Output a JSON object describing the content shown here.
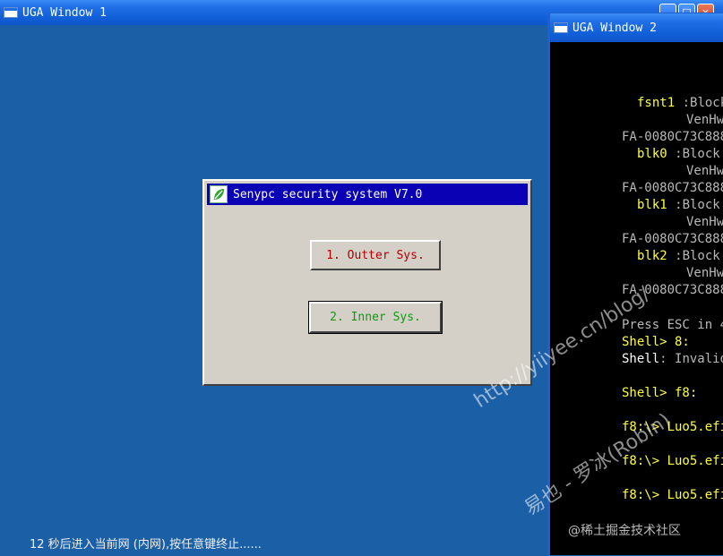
{
  "window1": {
    "title": "UGA Window 1",
    "controls": {
      "minimize": "_",
      "maximize": "□",
      "close": "×"
    }
  },
  "dialog": {
    "title": "Senypc security system V7.0",
    "buttons": [
      {
        "label": "1. Outter Sys.",
        "color": "#b00000"
      },
      {
        "label": "2. Inner Sys.",
        "color": "#0f9a0f"
      }
    ]
  },
  "status_text": "12 秒后进入当前网 (内网),按任意键终止......",
  "window2": {
    "title": "UGA Window 2",
    "console": {
      "lines": [
        {
          "a": "fsnt1",
          "b": " :Block"
        },
        {
          "a": "",
          "b": "VenHw"
        },
        {
          "a": "FA-0080C73C888",
          "b": ""
        },
        {
          "a": "blk0",
          "b": " :Block"
        },
        {
          "a": "",
          "b": "VenHw"
        },
        {
          "a": "FA-0080C73C888",
          "b": ""
        },
        {
          "a": "blk1",
          "b": " :Block"
        },
        {
          "a": "",
          "b": "VenHw"
        },
        {
          "a": "FA-0080C73C888",
          "b": ""
        },
        {
          "a": "blk2",
          "b": " :Block"
        },
        {
          "a": "",
          "b": "VenHw"
        },
        {
          "a": "FA-0080C73C888",
          "b": ""
        }
      ],
      "press_esc": "Press ESC in 4",
      "shell1": "Shell> 8:",
      "shell_invalid_a": "Shell",
      "shell_invalid_b": ": Invalid",
      "shell2": "Shell> f8:",
      "run1": "f8:\\> Luo5.efi",
      "run2": "f8:\\> Luo5.efi",
      "run3": "f8:\\> Luo5.efi"
    }
  },
  "watermark": {
    "line1": "http://yiiyee.cn/blog/",
    "line2": "易也 - 罗冰(Robin)",
    "credit": "@稀土掘金技术社区"
  },
  "colors": {
    "desktop": "#1b5fa6",
    "dialog_face": "#d4d0c8",
    "dialog_title": "#0a00b4",
    "console_yellow": "#ffff3c"
  }
}
